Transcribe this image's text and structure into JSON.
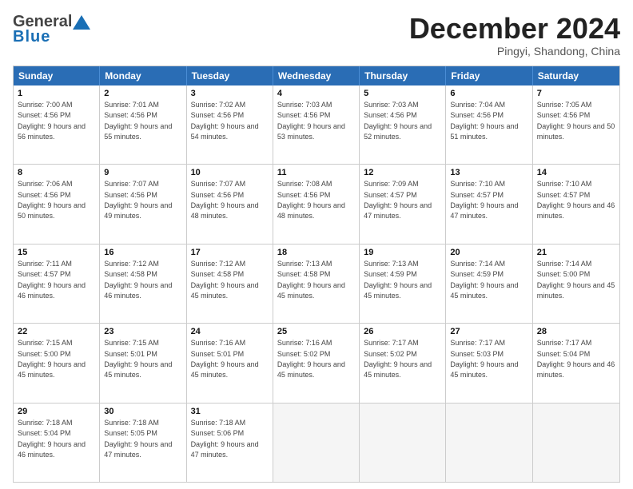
{
  "header": {
    "logo_general": "General",
    "logo_blue": "Blue",
    "month_title": "December 2024",
    "location": "Pingyi, Shandong, China"
  },
  "weekdays": [
    "Sunday",
    "Monday",
    "Tuesday",
    "Wednesday",
    "Thursday",
    "Friday",
    "Saturday"
  ],
  "weeks": [
    [
      {
        "day": "1",
        "rise": "Sunrise: 7:00 AM",
        "set": "Sunset: 4:56 PM",
        "daylight": "Daylight: 9 hours and 56 minutes."
      },
      {
        "day": "2",
        "rise": "Sunrise: 7:01 AM",
        "set": "Sunset: 4:56 PM",
        "daylight": "Daylight: 9 hours and 55 minutes."
      },
      {
        "day": "3",
        "rise": "Sunrise: 7:02 AM",
        "set": "Sunset: 4:56 PM",
        "daylight": "Daylight: 9 hours and 54 minutes."
      },
      {
        "day": "4",
        "rise": "Sunrise: 7:03 AM",
        "set": "Sunset: 4:56 PM",
        "daylight": "Daylight: 9 hours and 53 minutes."
      },
      {
        "day": "5",
        "rise": "Sunrise: 7:03 AM",
        "set": "Sunset: 4:56 PM",
        "daylight": "Daylight: 9 hours and 52 minutes."
      },
      {
        "day": "6",
        "rise": "Sunrise: 7:04 AM",
        "set": "Sunset: 4:56 PM",
        "daylight": "Daylight: 9 hours and 51 minutes."
      },
      {
        "day": "7",
        "rise": "Sunrise: 7:05 AM",
        "set": "Sunset: 4:56 PM",
        "daylight": "Daylight: 9 hours and 50 minutes."
      }
    ],
    [
      {
        "day": "8",
        "rise": "Sunrise: 7:06 AM",
        "set": "Sunset: 4:56 PM",
        "daylight": "Daylight: 9 hours and 50 minutes."
      },
      {
        "day": "9",
        "rise": "Sunrise: 7:07 AM",
        "set": "Sunset: 4:56 PM",
        "daylight": "Daylight: 9 hours and 49 minutes."
      },
      {
        "day": "10",
        "rise": "Sunrise: 7:07 AM",
        "set": "Sunset: 4:56 PM",
        "daylight": "Daylight: 9 hours and 48 minutes."
      },
      {
        "day": "11",
        "rise": "Sunrise: 7:08 AM",
        "set": "Sunset: 4:56 PM",
        "daylight": "Daylight: 9 hours and 48 minutes."
      },
      {
        "day": "12",
        "rise": "Sunrise: 7:09 AM",
        "set": "Sunset: 4:57 PM",
        "daylight": "Daylight: 9 hours and 47 minutes."
      },
      {
        "day": "13",
        "rise": "Sunrise: 7:10 AM",
        "set": "Sunset: 4:57 PM",
        "daylight": "Daylight: 9 hours and 47 minutes."
      },
      {
        "day": "14",
        "rise": "Sunrise: 7:10 AM",
        "set": "Sunset: 4:57 PM",
        "daylight": "Daylight: 9 hours and 46 minutes."
      }
    ],
    [
      {
        "day": "15",
        "rise": "Sunrise: 7:11 AM",
        "set": "Sunset: 4:57 PM",
        "daylight": "Daylight: 9 hours and 46 minutes."
      },
      {
        "day": "16",
        "rise": "Sunrise: 7:12 AM",
        "set": "Sunset: 4:58 PM",
        "daylight": "Daylight: 9 hours and 46 minutes."
      },
      {
        "day": "17",
        "rise": "Sunrise: 7:12 AM",
        "set": "Sunset: 4:58 PM",
        "daylight": "Daylight: 9 hours and 45 minutes."
      },
      {
        "day": "18",
        "rise": "Sunrise: 7:13 AM",
        "set": "Sunset: 4:58 PM",
        "daylight": "Daylight: 9 hours and 45 minutes."
      },
      {
        "day": "19",
        "rise": "Sunrise: 7:13 AM",
        "set": "Sunset: 4:59 PM",
        "daylight": "Daylight: 9 hours and 45 minutes."
      },
      {
        "day": "20",
        "rise": "Sunrise: 7:14 AM",
        "set": "Sunset: 4:59 PM",
        "daylight": "Daylight: 9 hours and 45 minutes."
      },
      {
        "day": "21",
        "rise": "Sunrise: 7:14 AM",
        "set": "Sunset: 5:00 PM",
        "daylight": "Daylight: 9 hours and 45 minutes."
      }
    ],
    [
      {
        "day": "22",
        "rise": "Sunrise: 7:15 AM",
        "set": "Sunset: 5:00 PM",
        "daylight": "Daylight: 9 hours and 45 minutes."
      },
      {
        "day": "23",
        "rise": "Sunrise: 7:15 AM",
        "set": "Sunset: 5:01 PM",
        "daylight": "Daylight: 9 hours and 45 minutes."
      },
      {
        "day": "24",
        "rise": "Sunrise: 7:16 AM",
        "set": "Sunset: 5:01 PM",
        "daylight": "Daylight: 9 hours and 45 minutes."
      },
      {
        "day": "25",
        "rise": "Sunrise: 7:16 AM",
        "set": "Sunset: 5:02 PM",
        "daylight": "Daylight: 9 hours and 45 minutes."
      },
      {
        "day": "26",
        "rise": "Sunrise: 7:17 AM",
        "set": "Sunset: 5:02 PM",
        "daylight": "Daylight: 9 hours and 45 minutes."
      },
      {
        "day": "27",
        "rise": "Sunrise: 7:17 AM",
        "set": "Sunset: 5:03 PM",
        "daylight": "Daylight: 9 hours and 45 minutes."
      },
      {
        "day": "28",
        "rise": "Sunrise: 7:17 AM",
        "set": "Sunset: 5:04 PM",
        "daylight": "Daylight: 9 hours and 46 minutes."
      }
    ],
    [
      {
        "day": "29",
        "rise": "Sunrise: 7:18 AM",
        "set": "Sunset: 5:04 PM",
        "daylight": "Daylight: 9 hours and 46 minutes."
      },
      {
        "day": "30",
        "rise": "Sunrise: 7:18 AM",
        "set": "Sunset: 5:05 PM",
        "daylight": "Daylight: 9 hours and 47 minutes."
      },
      {
        "day": "31",
        "rise": "Sunrise: 7:18 AM",
        "set": "Sunset: 5:06 PM",
        "daylight": "Daylight: 9 hours and 47 minutes."
      },
      {
        "day": "",
        "rise": "",
        "set": "",
        "daylight": ""
      },
      {
        "day": "",
        "rise": "",
        "set": "",
        "daylight": ""
      },
      {
        "day": "",
        "rise": "",
        "set": "",
        "daylight": ""
      },
      {
        "day": "",
        "rise": "",
        "set": "",
        "daylight": ""
      }
    ]
  ]
}
